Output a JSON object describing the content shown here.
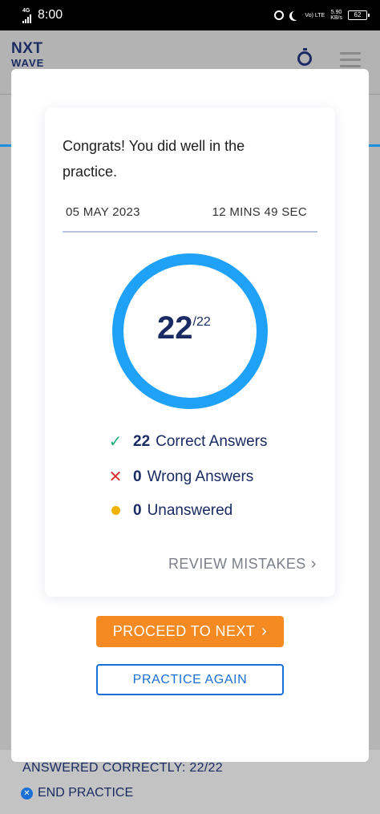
{
  "status_bar": {
    "network": "4G",
    "time": "8:00",
    "volte": "Vo) LTE",
    "speed_value": "5.90",
    "speed_unit": "KB/s",
    "battery": "62"
  },
  "app": {
    "logo_top": "NXT",
    "logo_bottom": "WAVE",
    "timer_icon": "stopwatch-icon",
    "menu_icon": "hamburger-icon"
  },
  "background": {
    "answered_text": "ANSWERED CORRECTLY: 22/22",
    "end_practice_label": "END PRACTICE"
  },
  "result": {
    "message": "Congrats! You did well in the practice.",
    "date": "05 MAY 2023",
    "duration": "12 MINS 49 SEC",
    "score": "22",
    "total": "/22",
    "score_fraction": 1.0,
    "ring_color": "#1ea1f6",
    "stats": {
      "correct_count": "22",
      "correct_label": "Correct Answers",
      "wrong_count": "0",
      "wrong_label": "Wrong Answers",
      "unanswered_count": "0",
      "unanswered_label": "Unanswered"
    },
    "review_label": "REVIEW MISTAKES"
  },
  "actions": {
    "proceed_label": "PROCEED TO NEXT",
    "proceed_color": "#f58a23",
    "practice_again_label": "PRACTICE AGAIN",
    "practice_again_color": "#1a6fd6"
  }
}
